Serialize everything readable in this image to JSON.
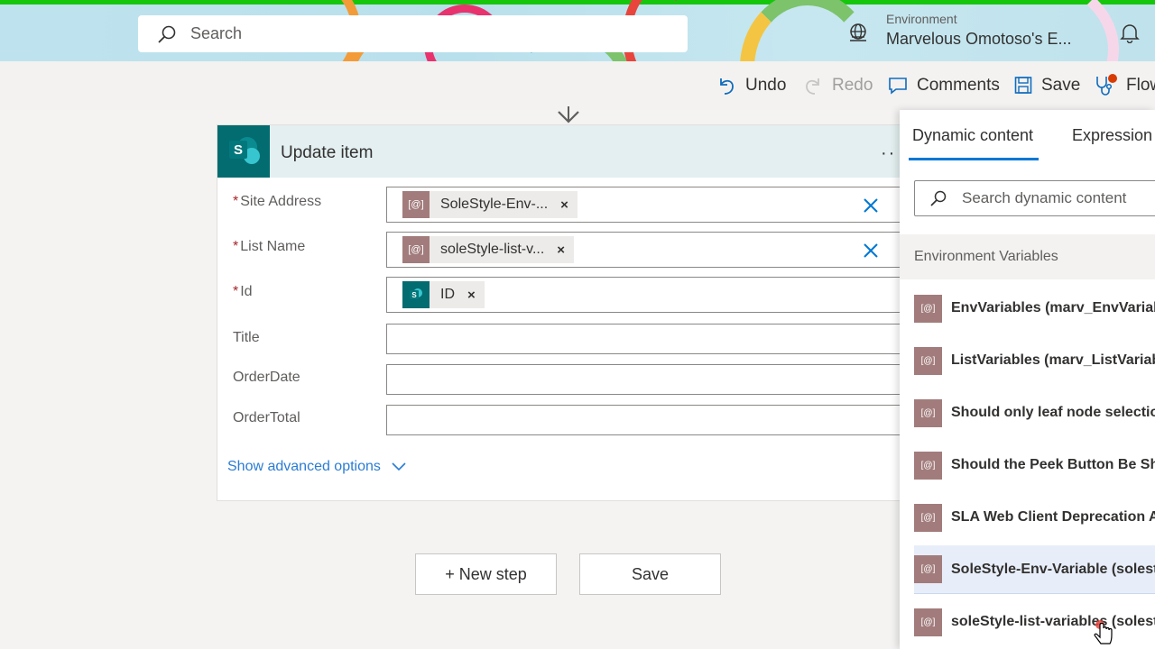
{
  "topbar": {
    "search_placeholder": "Search",
    "environment_label": "Environment",
    "environment_name": "Marvelous Omotoso's E..."
  },
  "commands": {
    "undo": "Undo",
    "redo": "Redo",
    "comments": "Comments",
    "save": "Save",
    "flow_checker": "Flow"
  },
  "action_card": {
    "title": "Update item",
    "fields": [
      {
        "label": "Site Address",
        "required": true,
        "token": "SoleStyle-Env-..."
      },
      {
        "label": "List Name",
        "required": true,
        "token": "soleStyle-list-v..."
      },
      {
        "label": "Id",
        "required": true,
        "token": "ID"
      },
      {
        "label": "Title",
        "required": false,
        "value": ""
      },
      {
        "label": "OrderDate",
        "required": false,
        "value": ""
      },
      {
        "label": "OrderTotal",
        "required": false,
        "value": ""
      }
    ],
    "show_advanced": "Show advanced options",
    "required_mark": "*",
    "remove_mark": "×",
    "more_dots": "··"
  },
  "footer_buttons": {
    "new_step": "+ New step",
    "save": "Save"
  },
  "dynamic_panel": {
    "tabs": [
      "Dynamic content",
      "Expression"
    ],
    "search_placeholder": "Search dynamic content",
    "section_title": "Environment Variables",
    "items": [
      "EnvVariables (marv_EnvVariables",
      "ListVariables (marv_ListVariables",
      "Should only leaf node selection",
      "Should the Peek Button Be Show",
      "SLA Web Client Deprecation Ack",
      "SoleStyle-Env-Variable (solestyl_",
      "soleStyle-list-variables (solestyl_"
    ],
    "token_icon_text": "[@]"
  },
  "colors": {
    "accent": "#0078d4",
    "sharepoint": "#036c70",
    "variable_token": "#a27c7c",
    "required": "#a4262c",
    "link": "#2b7cd3"
  }
}
